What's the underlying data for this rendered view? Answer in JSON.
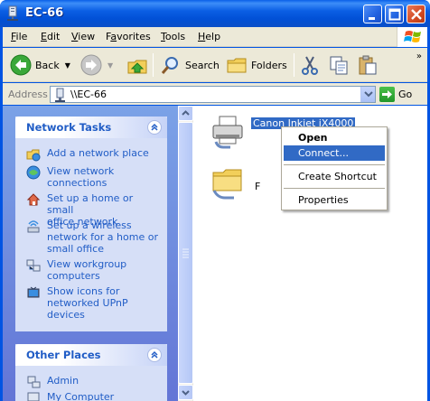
{
  "window": {
    "title": "EC-66"
  },
  "menubar": {
    "items": [
      {
        "label": "File",
        "key": "F"
      },
      {
        "label": "Edit",
        "key": "E"
      },
      {
        "label": "View",
        "key": "V"
      },
      {
        "label": "Favorites",
        "key": "a"
      },
      {
        "label": "Tools",
        "key": "T"
      },
      {
        "label": "Help",
        "key": "H"
      }
    ]
  },
  "toolbar": {
    "back_label": "Back",
    "search_label": "Search",
    "folders_label": "Folders"
  },
  "address": {
    "label": "Address",
    "value": "\\\\EC-66",
    "go_label": "Go"
  },
  "taskpane": {
    "network_tasks": {
      "title": "Network Tasks",
      "items": [
        {
          "lines": [
            "Add a network place"
          ],
          "icon": "network-place-icon"
        },
        {
          "lines": [
            "View network",
            "connections"
          ],
          "icon": "network-connections-icon"
        },
        {
          "lines": [
            "Set up a home or small",
            "office network"
          ],
          "icon": "home-network-icon"
        },
        {
          "lines": [
            "Set up a wireless",
            "network for a home or",
            "small office"
          ],
          "icon": "wireless-network-icon"
        },
        {
          "lines": [
            "View workgroup",
            "computers"
          ],
          "icon": "workgroup-icon"
        },
        {
          "lines": [
            "Show icons for",
            "networked UPnP",
            "devices"
          ],
          "icon": "upnp-icon"
        }
      ]
    },
    "other_places": {
      "title": "Other Places",
      "items": [
        {
          "lines": [
            "Admin"
          ],
          "icon": "admin-icon"
        },
        {
          "lines": [
            "My Computer"
          ],
          "icon": "my-computer-icon"
        }
      ]
    }
  },
  "files": {
    "printer_label": "Canon Inkjet iX4000",
    "folder_label": "F"
  },
  "context_menu": {
    "items": [
      "Open",
      "Connect...",
      "Create Shortcut",
      "Properties"
    ]
  },
  "colors": {
    "titlebar": "#0054e3",
    "selection": "#316ac5",
    "link": "#215dc6"
  }
}
